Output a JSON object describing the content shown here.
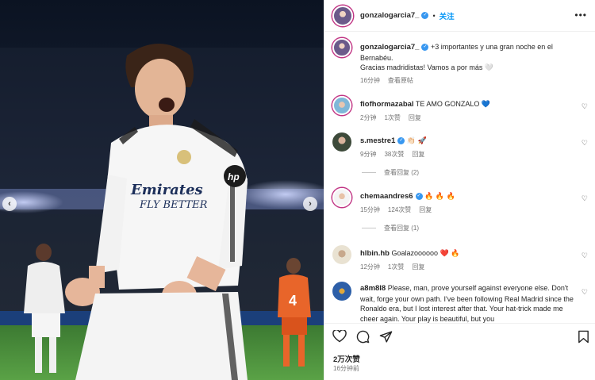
{
  "post": {
    "author": "gonzalogarcia7_",
    "follow_label": "关注",
    "more_label": "•••",
    "photo": {
      "shirt_sponsor": "Emirates",
      "shirt_slogan": "FLY BETTER",
      "shirt_brand": "hp",
      "background_player_number": "4"
    }
  },
  "caption": {
    "username": "gonzalogarcia7_",
    "text_line1": "+3 importantes y una gran noche en el",
    "text_line2": "Bernabéu.",
    "text_line3": "Gracias madridistas! Vamos a por más 🤍",
    "time": "16分钟",
    "translation_label": "查看原帖"
  },
  "comments": [
    {
      "username": "fiofhormazabal",
      "text": "TE AMO GONZALO 💙",
      "time": "2分钟",
      "likes": "1次赞",
      "reply": "回复",
      "view_replies": ""
    },
    {
      "username": "s.mestre1",
      "text": "👏🏻 🚀",
      "time": "9分钟",
      "likes": "38次赞",
      "reply": "回复",
      "view_replies": "查看回复 (2)"
    },
    {
      "username": "chemaandres6",
      "text": "🔥 🔥 🔥",
      "time": "15分钟",
      "likes": "124次赞",
      "reply": "回复",
      "view_replies": "查看回复 (1)"
    },
    {
      "username": "hlbin.hb",
      "text": "Goalazoooooo ❤️ 🔥",
      "time": "12分钟",
      "likes": "1次赞",
      "reply": "回复",
      "view_replies": ""
    },
    {
      "username": "a8m8l8",
      "text": "Please, man, prove yourself against everyone else. Don't wait, forge your own path. I've been following Real Madrid since the Ronaldo era, but I lost interest after that. Your hat-trick made me cheer again. Your play is beautiful, but you",
      "time": "",
      "likes": "",
      "reply": "",
      "view_replies": ""
    }
  ],
  "footer": {
    "likes": "2万次赞",
    "time": "16分钟前"
  },
  "colors": {
    "link_blue": "#0095f6",
    "verified_blue": "#3797f0",
    "muted_text": "#737373"
  }
}
